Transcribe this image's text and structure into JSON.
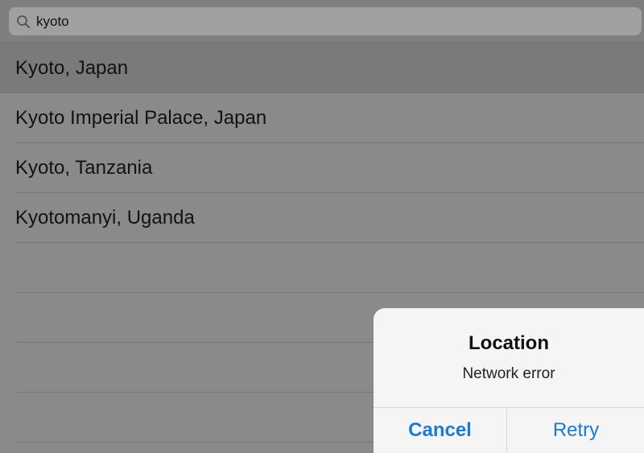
{
  "search": {
    "value": "kyoto",
    "icon": "search-icon"
  },
  "results": [
    {
      "label": "Kyoto, Japan",
      "selected": true
    },
    {
      "label": "Kyoto Imperial Palace, Japan",
      "selected": false
    },
    {
      "label": "Kyoto, Tanzania",
      "selected": false
    },
    {
      "label": "Kyotomanyi, Uganda",
      "selected": false
    }
  ],
  "alert": {
    "title": "Location",
    "message": "Network error",
    "cancel_label": "Cancel",
    "retry_label": "Retry"
  },
  "colors": {
    "accent": "#1a7bd1",
    "dimmed_background": "#8a8a8a",
    "alert_background": "#f5f5f5"
  }
}
